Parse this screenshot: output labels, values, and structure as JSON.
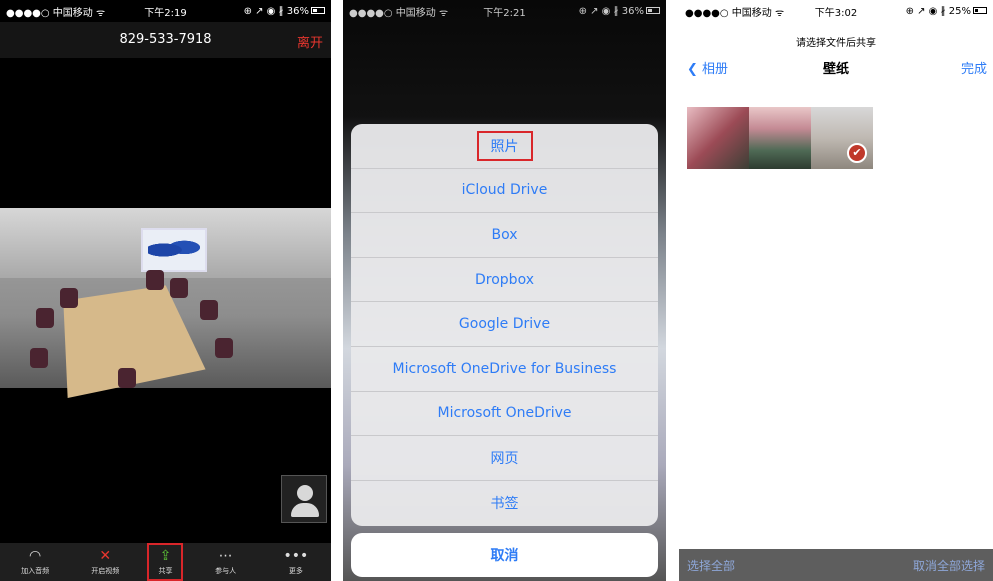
{
  "p1": {
    "status": {
      "carrier": "●●●●○ 中国移动 ᯤ",
      "time": "下午2:19",
      "right": "⊕ ↗ ◉ ∦ 36%",
      "battery_level": 0.36
    },
    "meeting_id": "829-533-7918",
    "leave_label": "离开",
    "toolbar": [
      {
        "icon": "◠",
        "label": "加入音频",
        "icon_name": "headphones-icon"
      },
      {
        "icon": "✕",
        "label": "开启视频",
        "icon_name": "video-off-icon"
      },
      {
        "icon": "⇪",
        "label": "共享",
        "icon_name": "share-icon"
      },
      {
        "icon": "⋯",
        "label": "参与人",
        "icon_name": "chat-icon"
      },
      {
        "icon": "•••",
        "label": "更多",
        "icon_name": "more-icon"
      }
    ],
    "share_highlight_color": "#d9262a"
  },
  "p2": {
    "status": {
      "carrier": "●●●●○ 中国移动 ᯤ",
      "time": "下午2:21",
      "right": "⊕ ↗ ◉ ∦ 36%",
      "battery_level": 0.36
    },
    "options": [
      "照片",
      "iCloud Drive",
      "Box",
      "Dropbox",
      "Google Drive",
      "Microsoft OneDrive for Business",
      "Microsoft OneDrive",
      "网页",
      "书签"
    ],
    "highlighted_index": 0,
    "cancel_label": "取消",
    "accent": "#2e7cf6"
  },
  "p3": {
    "status": {
      "carrier": "●●●●○ 中国移动 ᯤ",
      "time": "下午3:02",
      "right": "⊕ ↗ ◉ ∦ 25%",
      "battery_level": 0.25
    },
    "subtitle": "请选择文件后共享",
    "back_label": "相册",
    "title": "壁纸",
    "done_label": "完成",
    "thumbnails": [
      {
        "selected": false
      },
      {
        "selected": false
      },
      {
        "selected": true
      }
    ],
    "select_all_label": "选择全部",
    "deselect_all_label": "取消全部选择"
  }
}
